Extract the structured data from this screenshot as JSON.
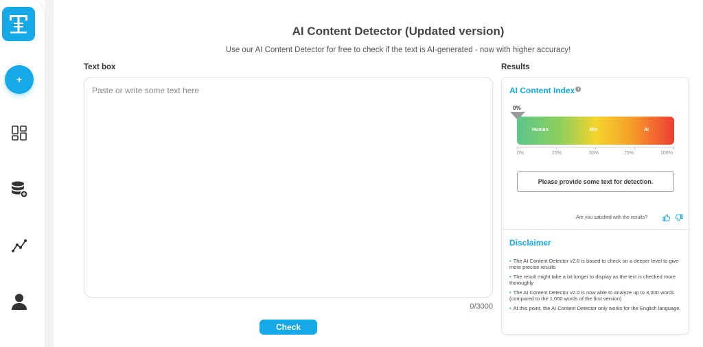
{
  "header": {
    "title": "AI Content Detector (Updated version)",
    "subtitle": "Use our AI Content Detector for free to check if the text is AI-generated - now with higher accuracy!"
  },
  "sidebar": {
    "logo_icon": "text-tool-logo-icon",
    "add_icon": "plus-icon",
    "items": [
      {
        "icon": "dashboard-grid-icon"
      },
      {
        "icon": "database-add-icon"
      },
      {
        "icon": "line-chart-icon"
      },
      {
        "icon": "user-icon"
      }
    ]
  },
  "textbox": {
    "label": "Text box",
    "placeholder": "Paste or write some text here",
    "value": "",
    "counter": "0/3000"
  },
  "check_button": "Check",
  "results": {
    "label": "Results",
    "index_title": "AI Content Index",
    "info_glyph": "i",
    "percent": "0%",
    "gauge_value": 0,
    "gauge_labels": [
      "Human",
      "Mix",
      "AI"
    ],
    "scale_ticks": [
      "0%",
      "25%",
      "50%",
      "75%",
      "100%"
    ],
    "status_message": "Please provide some text for detection.",
    "feedback_question": "Are you satisfied with the results?",
    "feedback_icons": [
      "thumbs-up-icon",
      "thumbs-down-icon"
    ]
  },
  "disclaimer": {
    "title": "Disclaimer",
    "bullet": "•",
    "items": [
      "The AI Content Detector v2.0 is based to check on a deeper level to give more precise results",
      "The result might take a bit longer to display as the text is checked more thoroughly",
      "The AI Content Detector v2.0 is now able to analyze up to 3,000 words (compared to the 1,000 words of the first version)",
      "At this point, the AI Content Detector only works for the English language."
    ]
  },
  "colors": {
    "accent": "#16a9e8",
    "gauge_human": "#5bc78a",
    "gauge_mix": "#f3d42c",
    "gauge_ai": "#ef3d32"
  }
}
